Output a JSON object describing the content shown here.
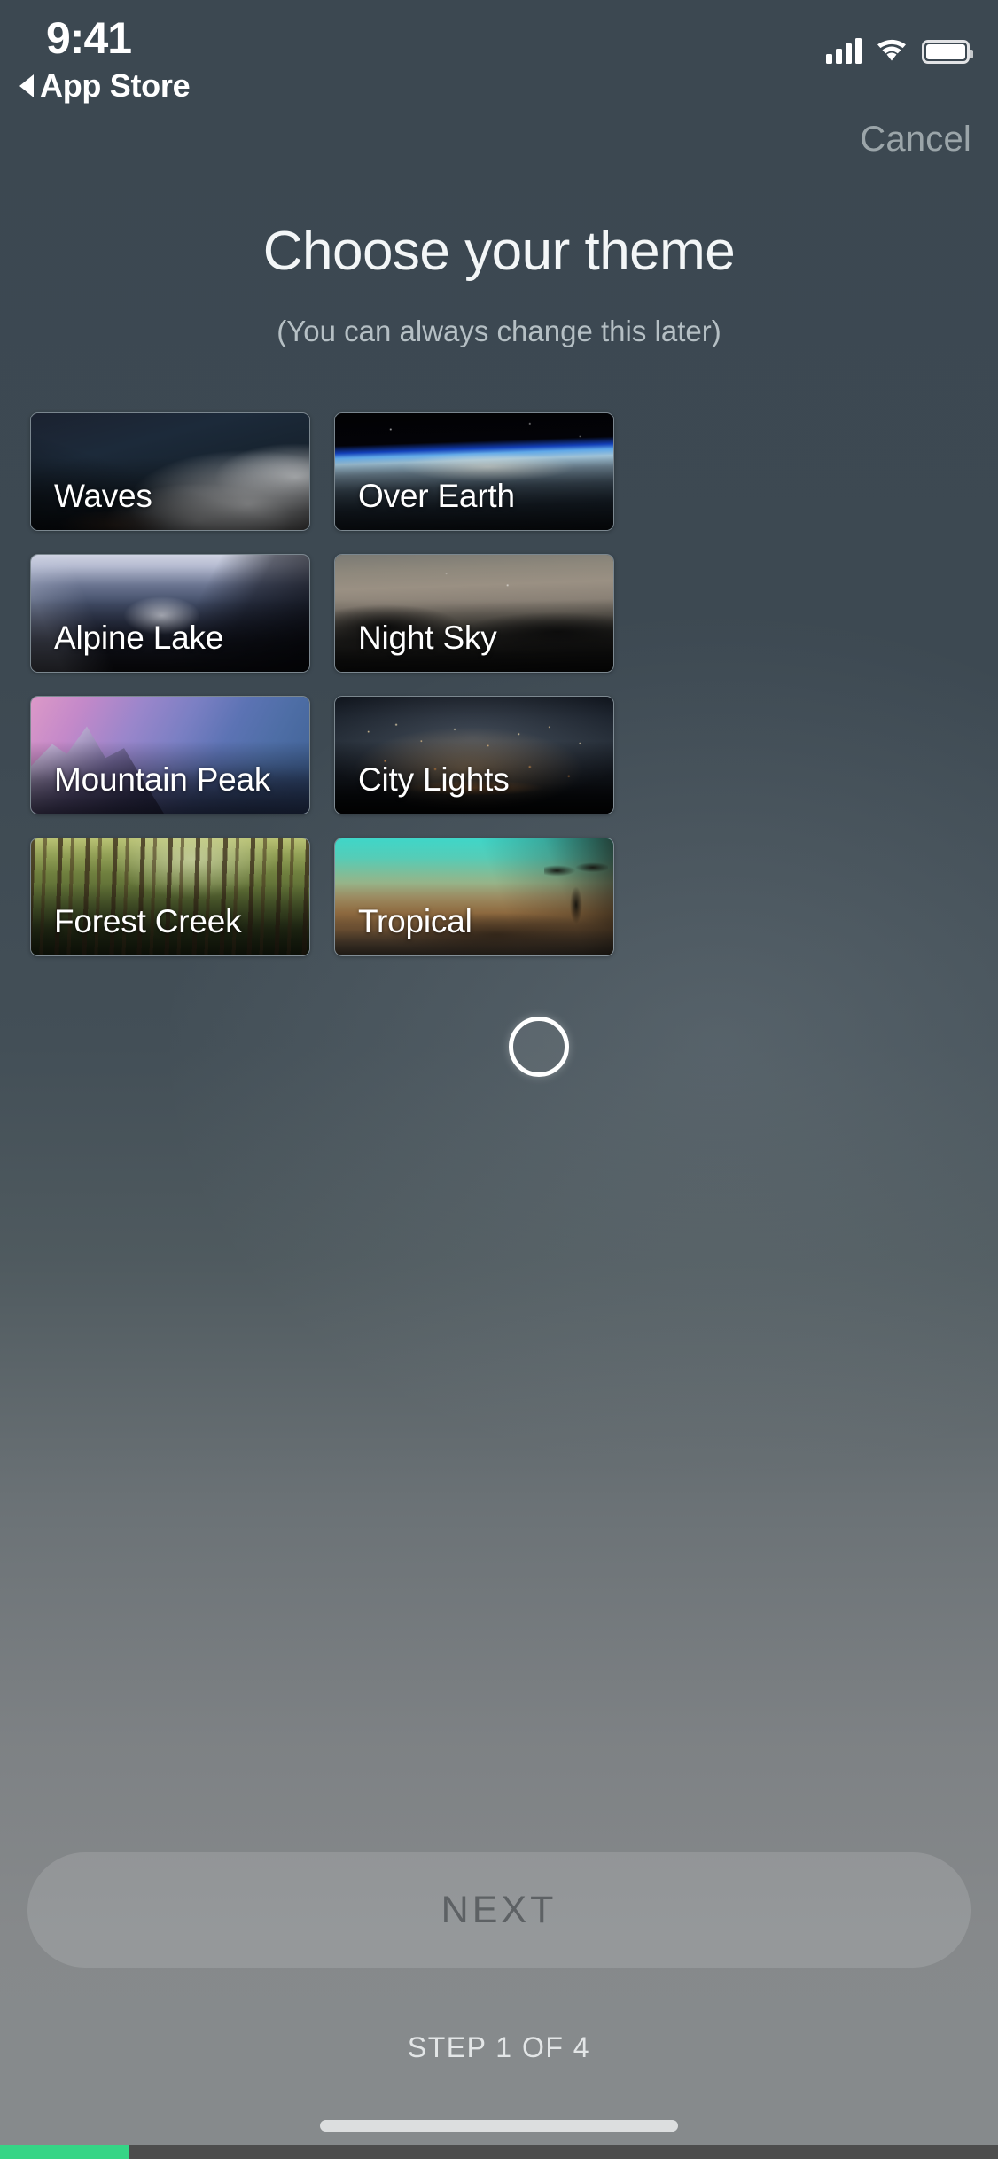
{
  "status_bar": {
    "time": "9:41",
    "back_label": "App Store",
    "back_arrow_icon": "triangle-left-icon",
    "cellular_icon": "cellular-bars-icon",
    "wifi_icon": "wifi-icon",
    "battery_icon": "battery-full-icon"
  },
  "nav": {
    "cancel_label": "Cancel"
  },
  "header": {
    "title": "Choose your theme",
    "subtitle": "(You can always change this later)"
  },
  "themes": [
    {
      "id": "waves",
      "label": "Waves",
      "art": "art-waves"
    },
    {
      "id": "over-earth",
      "label": "Over Earth",
      "art": "art-earth"
    },
    {
      "id": "alpine",
      "label": "Alpine Lake",
      "art": "art-alpine"
    },
    {
      "id": "night-sky",
      "label": "Night Sky",
      "art": "art-night"
    },
    {
      "id": "mountain",
      "label": "Mountain Peak",
      "art": "art-peak"
    },
    {
      "id": "city",
      "label": "City Lights",
      "art": "art-city"
    },
    {
      "id": "forest",
      "label": "Forest Creek",
      "art": "art-forest"
    },
    {
      "id": "tropical",
      "label": "Tropical",
      "art": "art-tropical"
    }
  ],
  "indicator": {
    "icon": "circle-outline-icon"
  },
  "footer": {
    "next_label": "NEXT",
    "step_label": "STEP 1 OF 4",
    "progress_percent": 13,
    "progress_color": "#35d586",
    "home_indicator_icon": "home-indicator-icon"
  }
}
